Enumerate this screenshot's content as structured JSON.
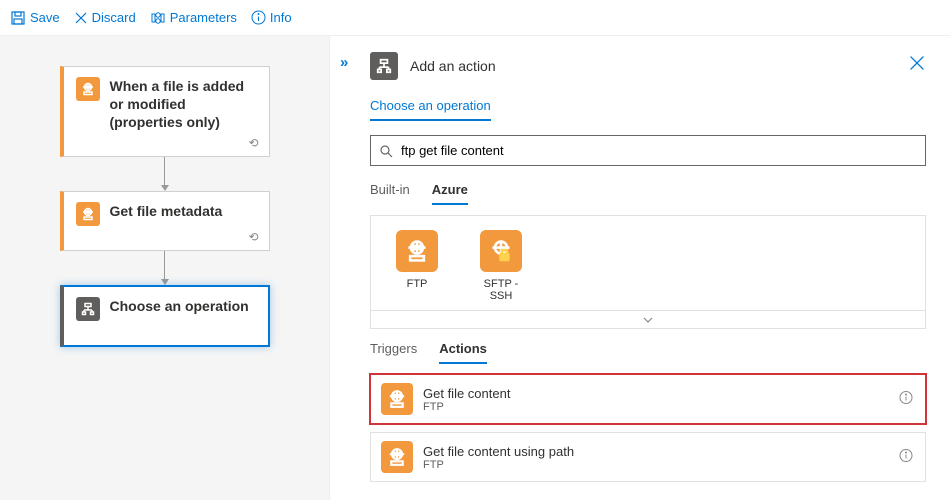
{
  "toolbar": {
    "save": "Save",
    "discard": "Discard",
    "parameters": "Parameters",
    "info": "Info"
  },
  "canvas": {
    "cards": [
      {
        "title": "When a file is added or modified (properties only)",
        "icon": "ftp"
      },
      {
        "title": "Get file metadata",
        "icon": "ftp"
      },
      {
        "title": "Choose an operation",
        "icon": "operation",
        "selected": true
      }
    ]
  },
  "panel": {
    "title": "Add an action",
    "section": "Choose an operation",
    "search": {
      "value": "ftp get file content",
      "placeholder": "Search"
    },
    "scope_tabs": {
      "builtin": "Built-in",
      "azure": "Azure",
      "active": "azure"
    },
    "connectors": [
      {
        "label": "FTP",
        "icon": "ftp"
      },
      {
        "label": "SFTP - SSH",
        "icon": "sftp"
      }
    ],
    "kind_tabs": {
      "triggers": "Triggers",
      "actions": "Actions",
      "active": "actions"
    },
    "actions": [
      {
        "title": "Get file content",
        "subtitle": "FTP",
        "highlight": true
      },
      {
        "title": "Get file content using path",
        "subtitle": "FTP"
      }
    ]
  }
}
